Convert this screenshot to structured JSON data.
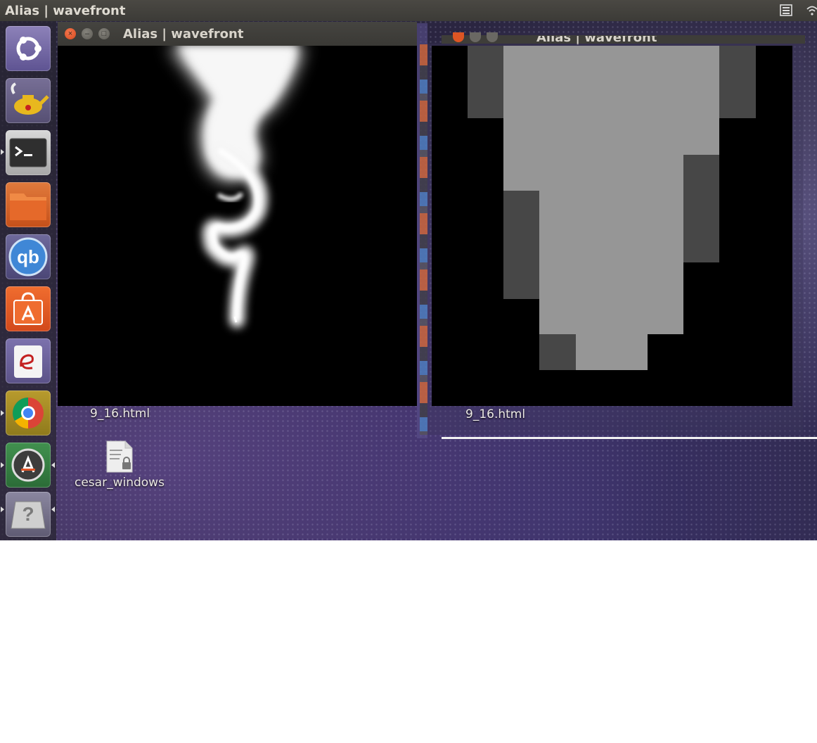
{
  "top_panel": {
    "title": "Alias | wavefront"
  },
  "launcher": {
    "items": [
      {
        "name": "ubuntu-dash"
      },
      {
        "name": "genie-lamp"
      },
      {
        "name": "terminal"
      },
      {
        "name": "files"
      },
      {
        "name": "qbittorrent",
        "label": "qb"
      },
      {
        "name": "software-center"
      },
      {
        "name": "document-viewer"
      },
      {
        "name": "chrome"
      },
      {
        "name": "software-updater"
      },
      {
        "name": "unknown-app",
        "label": "?"
      }
    ]
  },
  "window_left": {
    "title": "Alias | wavefront",
    "file_label": "9_16.html"
  },
  "window_right": {
    "title": "Alias | wavefront",
    "file_label": "9_16.html"
  },
  "desktop": {
    "file_label": "cesar_windows"
  },
  "colors": {
    "panel": "#3c3b37",
    "close": "#e0562a",
    "grid_light": "#969696",
    "grid_dark": "#474747"
  }
}
